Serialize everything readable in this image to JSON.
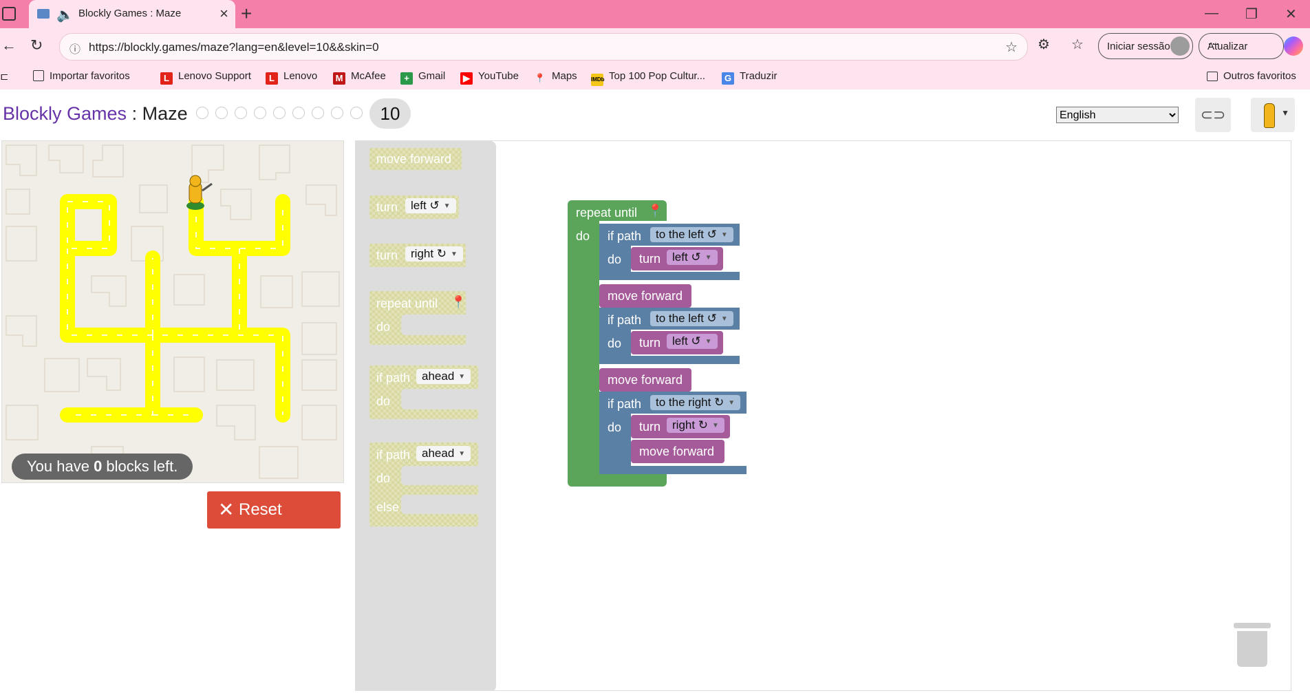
{
  "browser": {
    "tab_title": "Blockly Games : Maze",
    "url": "https://blockly.games/maze?lang=en&level=10&&skin=0",
    "signin_label": "Iniciar sessão",
    "update_label": "Atualizar",
    "bookmarks": [
      {
        "label": "Importar favoritos",
        "icon": "folder-import-icon"
      },
      {
        "label": "Lenovo Support",
        "icon": "lenovo-icon"
      },
      {
        "label": "Lenovo",
        "icon": "lenovo-icon"
      },
      {
        "label": "McAfee",
        "icon": "mcafee-icon"
      },
      {
        "label": "Gmail",
        "icon": "gmail-icon"
      },
      {
        "label": "YouTube",
        "icon": "youtube-icon"
      },
      {
        "label": "Maps",
        "icon": "maps-icon"
      },
      {
        "label": "Top 100 Pop Cultur...",
        "icon": "imdb-icon"
      },
      {
        "label": "Traduzir",
        "icon": "translate-icon"
      }
    ],
    "other_bookmarks": "Outros favoritos",
    "colors": {
      "chrome": "#f47fa9",
      "toolbar": "#ffe3ee"
    }
  },
  "header": {
    "app_name": "Blockly Games",
    "separator": " : ",
    "game_name": "Maze",
    "current_level": "10",
    "language": "English"
  },
  "maze": {
    "blocks_left_prefix": "You have ",
    "blocks_left_count": "0",
    "blocks_left_suffix": " blocks left.",
    "reset_label": "Reset"
  },
  "toolbox": {
    "move_forward": "move forward",
    "turn": "turn",
    "left": "left ↺",
    "right": "right ↻",
    "repeat_until": "repeat until",
    "do": "do",
    "if_path": "if path",
    "ahead": "ahead",
    "else": "else"
  },
  "program": {
    "repeat_until": "repeat until",
    "do": "do",
    "if_path": "if path",
    "to_the_left": "to the left ↺",
    "to_the_right": "to the right ↻",
    "turn": "turn",
    "left": "left ↺",
    "right": "right ↻",
    "move_forward": "move forward"
  },
  "colors": {
    "loop": "#5ba55b",
    "logic": "#5b80a5",
    "movement": "#a55b99",
    "path": "#ffff00",
    "reset": "#dd4b39"
  }
}
